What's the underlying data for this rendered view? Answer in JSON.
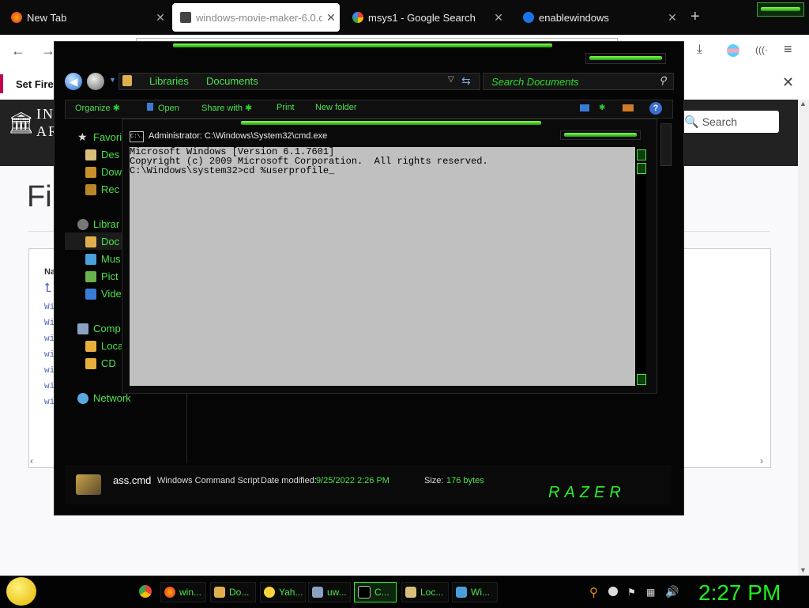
{
  "browser": {
    "tabs": [
      {
        "label": "New Tab",
        "active": false
      },
      {
        "label": "windows-movie-maker-6.0.d",
        "active": true
      },
      {
        "label": "msys1 - Google Search",
        "active": false
      },
      {
        "label": "enablewindows",
        "active": false
      }
    ],
    "notification": "Set Firef",
    "search_placeholder": "Search"
  },
  "page": {
    "logo_line1": "IN",
    "logo_line2": "AR",
    "title": "Fi",
    "list_header": "Na",
    "files": [
      "Wi",
      "Wi",
      "wi",
      "wi",
      "wi",
      "wi",
      "wi"
    ]
  },
  "explorer": {
    "breadcrumb": [
      "Libraries",
      "Documents"
    ],
    "search_placeholder": "Search Documents",
    "commands": [
      "Organize",
      "Open",
      "Share with",
      "Print",
      "New folder"
    ],
    "nav": {
      "favorites": "Favori",
      "favorites_items": [
        "Des",
        "Dow",
        "Rec"
      ],
      "libraries": "Librar",
      "libraries_items": [
        "Doc",
        "Mus",
        "Pict",
        "Vide"
      ],
      "computer": "Comp",
      "computer_items": [
        "Loca",
        "CD"
      ],
      "network": "Network"
    },
    "details": {
      "filename": "ass.cmd",
      "type": "Windows Command Script",
      "modified_label": "Date modified:",
      "modified_value": "9/25/2022 2:26 PM",
      "size_label": "Size:",
      "size_value": "176 bytes",
      "brand": "RAZER"
    }
  },
  "cmd": {
    "title": "Administrator: C:\\Windows\\System32\\cmd.exe",
    "icon_text": "C:\\.",
    "lines": [
      "Microsoft Windows [Version 6.1.7601]",
      "Copyright (c) 2009 Microsoft Corporation.  All rights reserved.",
      "",
      "C:\\Windows\\system32>cd %userprofile_"
    ]
  },
  "taskbar": {
    "items": [
      "win...",
      "Do...",
      "Yah...",
      "uw...",
      "C...",
      "Loc...",
      "Wi..."
    ],
    "clock": "2:27 PM"
  }
}
